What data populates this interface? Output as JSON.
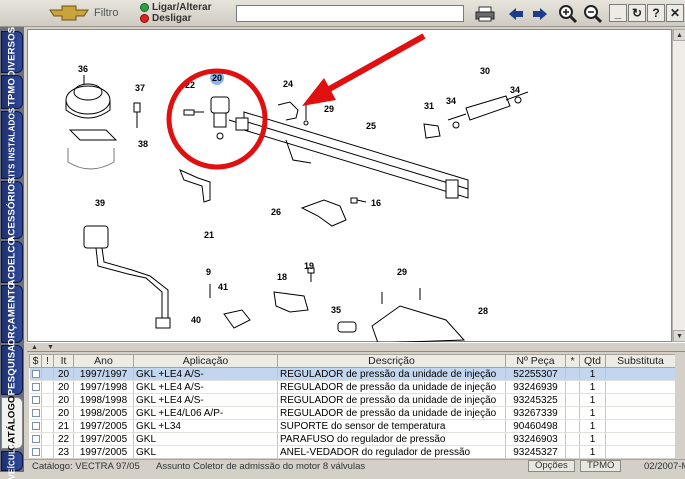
{
  "toolbar": {
    "filter_label": "Filtro",
    "power_on_label": "Ligar/Alterar",
    "power_off_label": "Desligar",
    "search_value": ""
  },
  "side_tabs": [
    "DIVERSOS",
    "TPMO",
    "KITS INSTALADOS",
    "ACESSÓRIOS",
    "ACDELCO",
    "ORÇAMENTO",
    "PESQUISA",
    "CATÁLOGO",
    "VEÍCULO"
  ],
  "diagram": {
    "labels": [
      "20",
      "22",
      "24",
      "29",
      "25",
      "36",
      "37",
      "38",
      "31",
      "34",
      "30",
      "34",
      "21",
      "26",
      "16",
      "39",
      "9",
      "41",
      "40",
      "18",
      "19",
      "35",
      "29",
      "28"
    ]
  },
  "table": {
    "columns": [
      "$",
      "!",
      "It",
      "Ano",
      "Aplicação",
      "Descrição",
      "Nº Peça",
      "*",
      "Qtd",
      "Substituta"
    ],
    "rows": [
      {
        "it": "20",
        "ano": "1997/1997",
        "aplicacao": "GKL +LE4 A/S-",
        "descricao": "REGULADOR de pressão da unidade de injeção",
        "peca": "52255307",
        "qtd": "1",
        "selected": true
      },
      {
        "it": "20",
        "ano": "1997/1998",
        "aplicacao": "GKL +LE4 A/S-",
        "descricao": "REGULADOR de pressão da unidade de injeção",
        "peca": "93246939",
        "qtd": "1",
        "selected": false
      },
      {
        "it": "20",
        "ano": "1998/1998",
        "aplicacao": "GKL +LE4 A/S-",
        "descricao": "REGULADOR de pressão da unidade de injeção",
        "peca": "93245325",
        "qtd": "1",
        "selected": false
      },
      {
        "it": "20",
        "ano": "1998/2005",
        "aplicacao": "GKL +LE4/L06 A/P-",
        "descricao": "REGULADOR de pressão da unidade de injeção",
        "peca": "93267339",
        "qtd": "1",
        "selected": false
      },
      {
        "it": "21",
        "ano": "1997/2005",
        "aplicacao": "GKL +L34",
        "descricao": "SUPORTE do sensor de temperatura",
        "peca": "90460498",
        "qtd": "1",
        "selected": false
      },
      {
        "it": "22",
        "ano": "1997/2005",
        "aplicacao": "GKL",
        "descricao": "PARAFUSO do regulador de pressão",
        "peca": "93246903",
        "qtd": "1",
        "selected": false
      },
      {
        "it": "23",
        "ano": "1997/2005",
        "aplicacao": "GKL",
        "descricao": "ANEL-VEDADOR do regulador de pressão",
        "peca": "93245327",
        "qtd": "1",
        "selected": false
      }
    ]
  },
  "status": {
    "catalog": "Catálogo: VECTRA 97/05",
    "subject": "Assunto Coletor de admissão do motor 8 válvulas",
    "options_label": "Opções",
    "tpmo_label": "TPMO",
    "date": "02/2007-M"
  },
  "colors": {
    "tab_blue": "#1f3275",
    "selection": "#c3d6ef",
    "highlight_red": "#e01010"
  }
}
